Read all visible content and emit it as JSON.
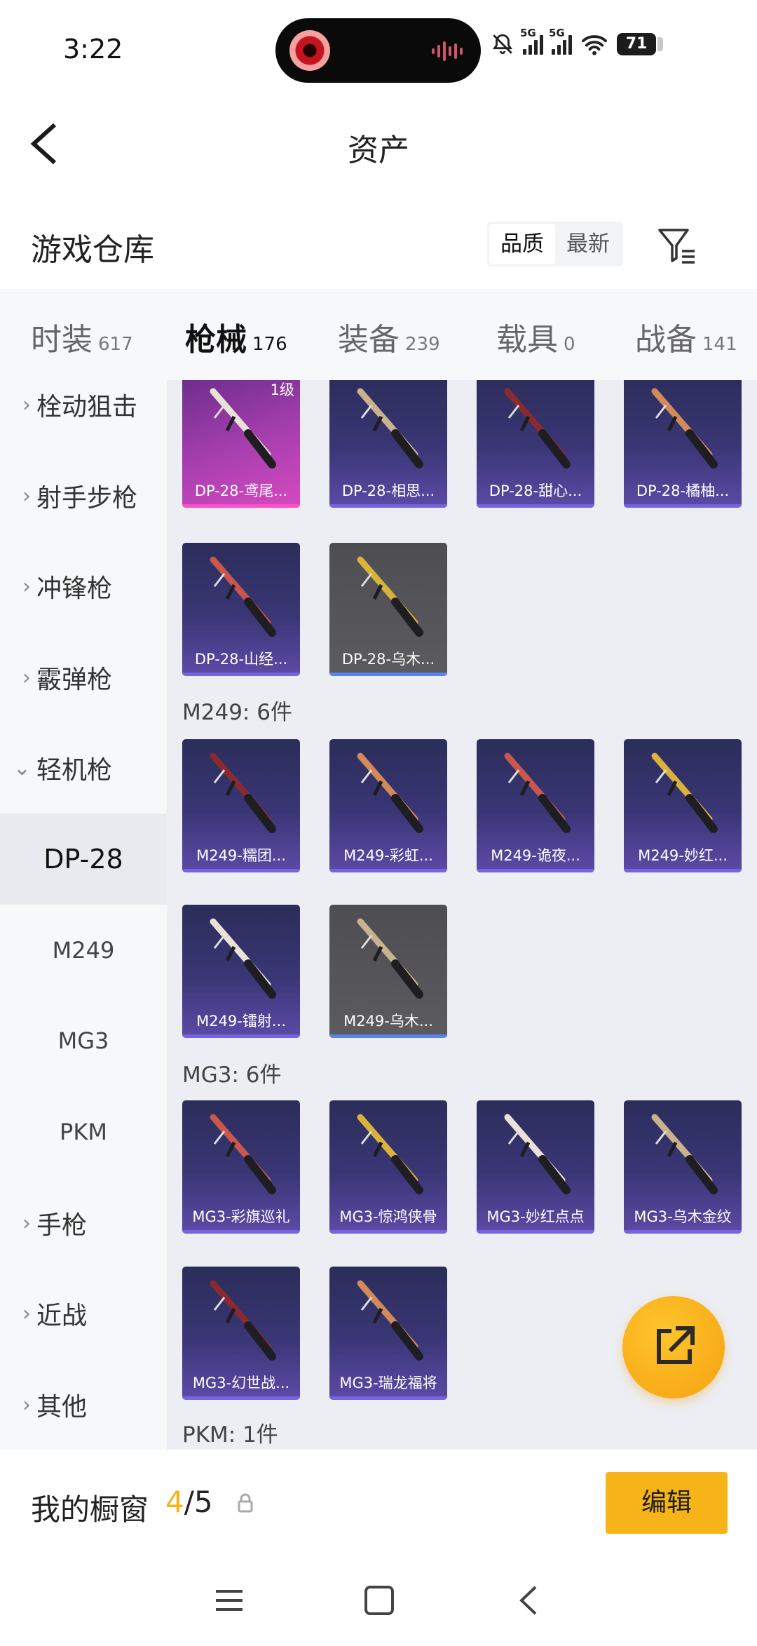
{
  "status_bar": {
    "time": "3:22",
    "network_1": "5G",
    "network_2": "5G",
    "battery": "71"
  },
  "header": {
    "title": "资产"
  },
  "warehouse": {
    "title": "游戏仓库",
    "sort_options": [
      "品质",
      "最新"
    ],
    "active_sort": "品质"
  },
  "category_tabs": [
    {
      "label": "时装",
      "count": "617"
    },
    {
      "label": "枪械",
      "count": "176",
      "active": true
    },
    {
      "label": "装备",
      "count": "239"
    },
    {
      "label": "载具",
      "count": "0"
    },
    {
      "label": "战备",
      "count": "141"
    }
  ],
  "sidebar": {
    "items": [
      {
        "label": "栓动狙击",
        "chevron": "›"
      },
      {
        "label": "射手步枪",
        "chevron": "›"
      },
      {
        "label": "冲锋枪",
        "chevron": "›"
      },
      {
        "label": "霰弹枪",
        "chevron": "›"
      },
      {
        "label": "轻机枪",
        "chevron": "⌄"
      }
    ],
    "sub_items": [
      "DP-28",
      "M249",
      "MG3",
      "PKM"
    ],
    "selected_sub": "DP-28",
    "items_after": [
      {
        "label": "手枪",
        "chevron": "›"
      },
      {
        "label": "近战",
        "chevron": "›"
      },
      {
        "label": "其他",
        "chevron": "›"
      }
    ]
  },
  "grid": {
    "dp28_items": [
      {
        "name": "DP-28-鸢尾...",
        "level": "1级",
        "style": "pink"
      },
      {
        "name": "DP-28-相思...",
        "style": "purple"
      },
      {
        "name": "DP-28-甜心...",
        "style": "purple"
      },
      {
        "name": "DP-28-橘柚...",
        "style": "purple"
      },
      {
        "name": "DP-28-山经...",
        "style": "purple"
      },
      {
        "name": "DP-28-乌木...",
        "style": "grey"
      }
    ],
    "m249_label": "M249: 6件",
    "m249_items": [
      {
        "name": "M249-糯团...",
        "style": "purple"
      },
      {
        "name": "M249-彩虹...",
        "style": "purple"
      },
      {
        "name": "M249-诡夜...",
        "style": "purple"
      },
      {
        "name": "M249-妙红...",
        "style": "purple"
      },
      {
        "name": "M249-镭射...",
        "style": "purple"
      },
      {
        "name": "M249-乌木...",
        "style": "grey"
      }
    ],
    "mg3_label": "MG3: 6件",
    "mg3_items": [
      {
        "name": "MG3-彩旗巡礼",
        "style": "purple"
      },
      {
        "name": "MG3-惊鸿侠骨",
        "style": "purple"
      },
      {
        "name": "MG3-妙红点点",
        "style": "purple"
      },
      {
        "name": "MG3-乌木金纹",
        "style": "purple"
      },
      {
        "name": "MG3-幻世战...",
        "style": "purple"
      },
      {
        "name": "MG3-瑞龙福将",
        "style": "purple"
      }
    ],
    "pkm_label": "PKM: 1件"
  },
  "showcase": {
    "title": "我的橱窗",
    "current": "4",
    "total": "/5",
    "edit_label": "编辑"
  },
  "colors": {
    "accent": "#f5b21b",
    "card_purple": "#3a3676",
    "card_grey": "#55555a",
    "card_pink": "#b941b6"
  }
}
